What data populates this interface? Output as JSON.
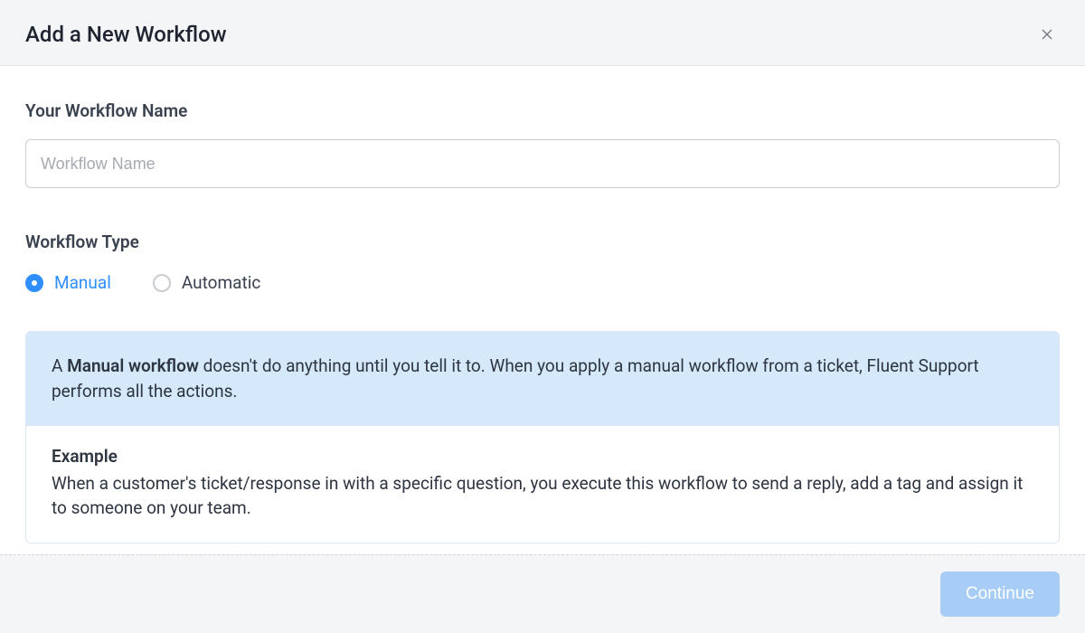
{
  "header": {
    "title": "Add a New Workflow"
  },
  "nameField": {
    "label": "Your Workflow Name",
    "placeholder": "Workflow Name",
    "value": ""
  },
  "typeField": {
    "label": "Workflow Type",
    "options": [
      {
        "value": "manual",
        "label": "Manual",
        "selected": true
      },
      {
        "value": "automatic",
        "label": "Automatic",
        "selected": false
      }
    ]
  },
  "info": {
    "desc_prefix": "A ",
    "desc_bold": "Manual workflow",
    "desc_rest": " doesn't do anything until you tell it to. When you apply a manual workflow from a ticket, Fluent Support performs all the actions.",
    "example_title": "Example",
    "example_body": "When a customer's ticket/response in with a specific question, you execute this workflow to send a reply, add a tag and assign it to someone on your team."
  },
  "footer": {
    "continue": "Continue"
  }
}
